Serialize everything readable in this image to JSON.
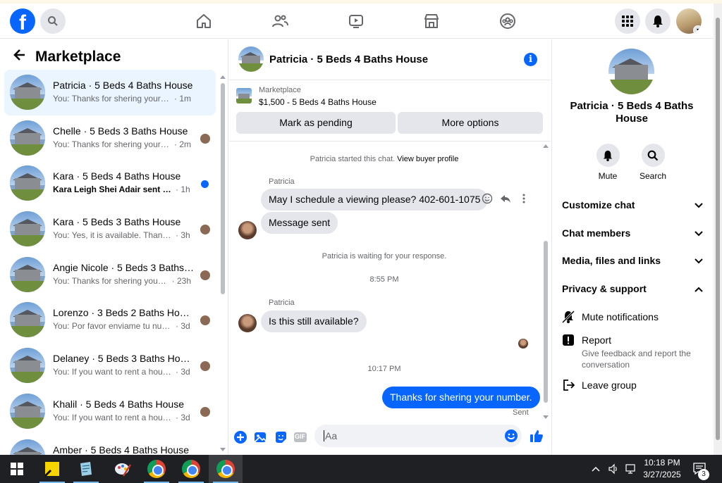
{
  "top_nav": {
    "logo": "f",
    "icons": [
      "search-icon",
      "home-icon",
      "friends-icon",
      "video-icon",
      "marketplace-icon",
      "groups-icon",
      "menu-grid-icon",
      "bell-icon"
    ]
  },
  "left": {
    "title": "Marketplace",
    "conversations": [
      {
        "name": "Patricia · 5 Beds 4 Baths House",
        "preview": "You: Thanks for shering your num...",
        "time": "· 1m",
        "active": true,
        "indicator": "none"
      },
      {
        "name": "Chelle · 5 Beds 3 Baths House",
        "preview": "You: Thanks for shering your nu...",
        "time": "· 2m",
        "active": false,
        "indicator": "avatar"
      },
      {
        "name": "Kara · 5 Beds 4 Baths House",
        "preview": "Kara Leigh Shei Adair sent you ...",
        "time": "· 1h",
        "active": false,
        "indicator": "unread",
        "unread": true
      },
      {
        "name": "Kara · 5 Beds 3 Baths House",
        "preview": "You: Yes, it is available. Thank yo...",
        "time": "· 3h",
        "active": false,
        "indicator": "avatar"
      },
      {
        "name": "Angie Nicole · 5 Beds 3 Baths ...",
        "preview": "You: Thanks for shering your n...",
        "time": "· 23h",
        "active": false,
        "indicator": "avatar"
      },
      {
        "name": "Lorenzo · 3 Beds 2 Baths House",
        "preview": "You: Por favor enviame tu nume...",
        "time": "· 3d",
        "active": false,
        "indicator": "avatar"
      },
      {
        "name": "Delaney · 5 Beds 3 Baths House",
        "preview": "You: If you want to rent a house,...",
        "time": "· 3d",
        "active": false,
        "indicator": "avatar"
      },
      {
        "name": "Khalil · 5 Beds 4 Baths House",
        "preview": "You: If you want to rent a house,...",
        "time": "· 3d",
        "active": false,
        "indicator": "avatar"
      },
      {
        "name": "Amber · 5 Beds 4 Baths House",
        "preview": "",
        "time": "",
        "active": false,
        "indicator": "none"
      }
    ]
  },
  "chat": {
    "title": "Patricia · 5 Beds 4 Baths House",
    "listing_label": "Marketplace",
    "listing_price": "$1,500 - 5 Beds 4 Baths House",
    "btn_pending": "Mark as pending",
    "btn_more": "More options",
    "started_text": "Patricia started this chat.",
    "view_profile": "View buyer profile",
    "sender1": "Patricia",
    "msg1": "May I schedule a viewing please? 402-601-1075",
    "msg2": "Message sent",
    "waiting": "Patricia is waiting for your response.",
    "time1": "8:55 PM",
    "sender2": "Patricia",
    "msg3": "Is this still available?",
    "time2": "10:17 PM",
    "msg4": "Thanks for shering your number.",
    "sent": "Sent",
    "input_placeholder": "Aa",
    "gif_label": "GIF"
  },
  "right": {
    "title": "Patricia · 5 Beds 4 Baths House",
    "mute": "Mute",
    "search": "Search",
    "customize": "Customize chat",
    "members": "Chat members",
    "media": "Media, files and links",
    "privacy": "Privacy & support",
    "mute_notifications": "Mute notifications",
    "report": "Report",
    "report_sub": "Give feedback and report the conversation",
    "leave": "Leave group"
  },
  "taskbar": {
    "time": "10:18 PM",
    "date": "3/27/2025",
    "notifications": "3"
  },
  "colors": {
    "accent": "#0866ff",
    "bubble_in": "#e4e6eb",
    "selected": "#ebf5ff"
  }
}
